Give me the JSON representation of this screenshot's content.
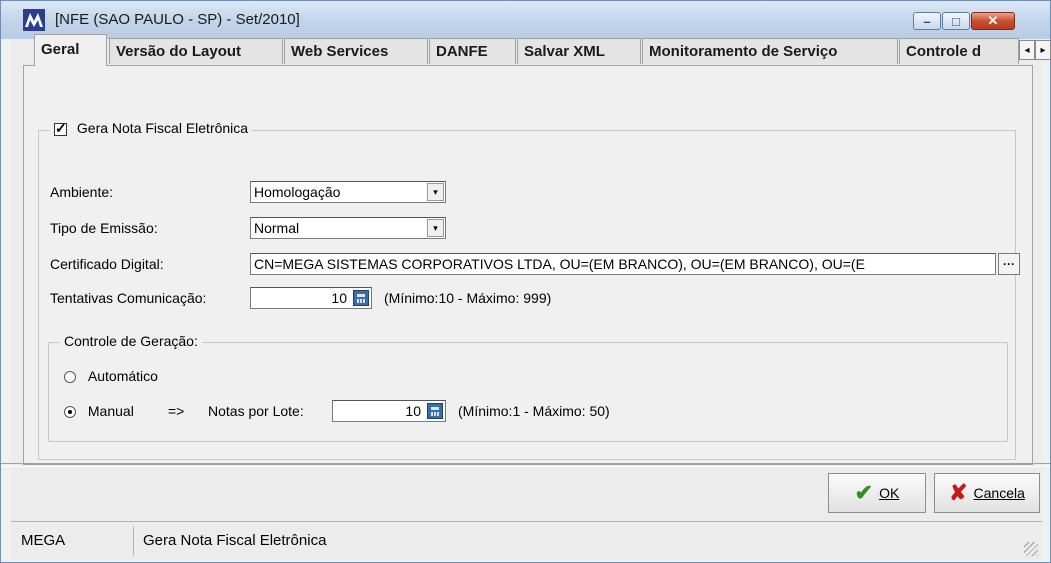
{
  "window": {
    "title": "[NFE (SAO PAULO - SP) - Set/2010]",
    "controls": {
      "minimize": "–",
      "maximize": "□",
      "close": "✕"
    }
  },
  "tabs": [
    {
      "label": "Geral",
      "active": true
    },
    {
      "label": "Versão do Layout",
      "active": false
    },
    {
      "label": "Web Services",
      "active": false
    },
    {
      "label": "DANFE",
      "active": false
    },
    {
      "label": "Salvar XML",
      "active": false
    },
    {
      "label": "Monitoramento de Serviço",
      "active": false
    },
    {
      "label": "Controle d",
      "active": false
    }
  ],
  "tab_scroll": {
    "left": "◂",
    "right": "▸"
  },
  "general": {
    "gera_nfe_label": "Gera Nota Fiscal Eletrônica",
    "gera_nfe_checked": true,
    "check_mark": "✓",
    "ambiente_label": "Ambiente:",
    "ambiente_value": "Homologação",
    "tipo_emissao_label": "Tipo de Emissão:",
    "tipo_emissao_value": "Normal",
    "certificado_label": "Certificado Digital:",
    "certificado_value": "CN=MEGA SISTEMAS CORPORATIVOS LTDA, OU=(EM BRANCO), OU=(EM BRANCO), OU=(E",
    "ellipsis": "···",
    "tentativas_label": "Tentativas Comunicação:",
    "tentativas_value": "10",
    "tentativas_hint": "(Mínimo:10 - Máximo: 999)",
    "combo_arrow": "▾"
  },
  "controle_geracao": {
    "title": "Controle de Geração:",
    "automatico_label": "Automático",
    "automatico_selected": false,
    "manual_label": "Manual",
    "manual_selected": true,
    "arrow": "=>",
    "notas_lote_label": "Notas por Lote:",
    "notas_lote_value": "10",
    "notas_lote_hint": "(Mínimo:1 - Máximo: 50)"
  },
  "buttons": {
    "ok_label": "OK",
    "ok_icon": "✔",
    "cancel_label": "Cancela",
    "cancel_icon": "✘"
  },
  "statusbar": {
    "panel1": "MEGA",
    "panel2": "Gera Nota Fiscal Eletrônica"
  }
}
